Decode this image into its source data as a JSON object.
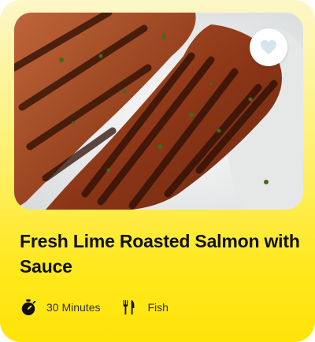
{
  "card": {
    "title": "Fresh Lime Roasted Salmon with Sauce",
    "image_icon": "salmon-photo",
    "favorite_icon": "heart-icon",
    "meta": {
      "time": {
        "icon": "stopwatch-icon",
        "label": "30 Minutes"
      },
      "category": {
        "icon": "fork-knife-icon",
        "label": "Fish"
      }
    }
  },
  "colors": {
    "card_gradient_top": "#fdf7c9",
    "card_gradient_bottom": "#ffe409",
    "heart": "#d3e6ee",
    "text": "#111111"
  }
}
